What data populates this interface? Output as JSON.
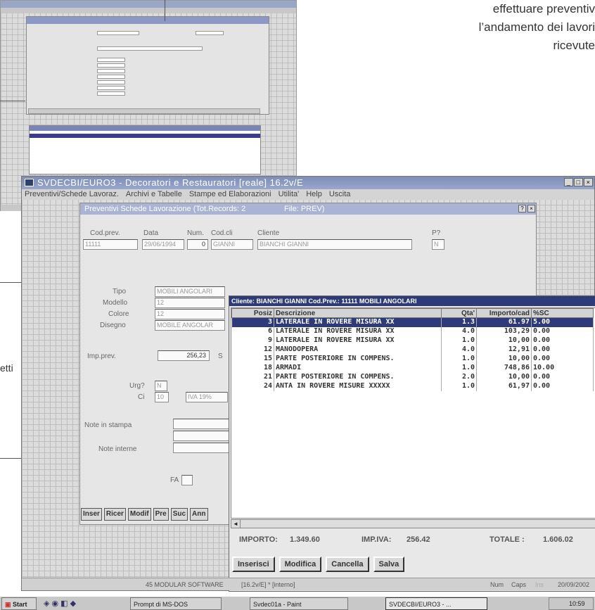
{
  "caption": {
    "lines": [
      "effettuare preventiv",
      "l’andamento dei lavori",
      "ricevute"
    ],
    "side_label": "etti"
  },
  "window": {
    "title": "SVDECBI/EURO3 - Decoratori e Restauratori        [reale]   16.2v/E",
    "menu": [
      "Preventivi/Schede Lavoraz.",
      "Archivi e Tabelle",
      "Stampe ed Elaborazioni",
      "Utilita'",
      "Help",
      "Uscita"
    ]
  },
  "form": {
    "title": "Preventivi Schede Lavorazione  (Tot.Records: 2",
    "file": "File: PREV)",
    "labels": {
      "codprev": "Cod.prev.",
      "data": "Data",
      "num": "Num.",
      "codcli": "Cod.cli",
      "cliente": "Cliente",
      "p": "P?",
      "tipo": "Tipo",
      "modello": "Modello",
      "colore": "Colore",
      "disegno": "Disegno",
      "impprev": "Imp.prev.",
      "s": "S",
      "urg": "Urg?",
      "ci": "Ci",
      "note_stampa": "Note in stampa",
      "note_interne": "Note interne",
      "fa": "FA"
    },
    "values": {
      "codprev": "11111",
      "data": "29/06/1994",
      "num": "0",
      "codcli": "GIANNI",
      "cliente": "BIANCHI GIANNI",
      "p": "N",
      "tipo": "MOBILI ANGOLARI",
      "modello": "12",
      "colore": "12",
      "disegno": "MOBILE ANGOLAR",
      "impprev": "256,23",
      "urg": "N",
      "ci": "10",
      "iva": "IVA 19%"
    },
    "buttons": [
      "Inser",
      "Ricer",
      "Modif",
      "Pre",
      "Suc",
      "Ann"
    ]
  },
  "table": {
    "title": "Cliente: BIANCHI GIANNI  Cod.Prev.: 11111  MOBILI ANGOLARI",
    "headers": [
      "Posiz",
      "Descrizione",
      "Qta'",
      "Importo/cad",
      "%SC"
    ],
    "rows": [
      [
        "3",
        "LATERALE IN ROVERE MISURA XX",
        "1.3",
        "61.97",
        "5.00"
      ],
      [
        "6",
        "LATERALE IN ROVERE MISURA XX",
        "4.0",
        "103,29",
        "0.00"
      ],
      [
        "9",
        "LATERALE IN ROVERE MISURA XX",
        "1.0",
        "10,00",
        "0.00"
      ],
      [
        "12",
        "MANODOPERA",
        "4.0",
        "12,91",
        "0.00"
      ],
      [
        "15",
        "PARTE POSTERIORE IN COMPENS.",
        "1.0",
        "10,00",
        "0.00"
      ],
      [
        "18",
        "ARMADI",
        "1.0",
        "748,86",
        "10.00"
      ],
      [
        "21",
        "PARTE POSTERIORE IN COMPENS.",
        "2.0",
        "10,00",
        "0.00"
      ],
      [
        "24",
        "ANTA IN ROVERE MISURE XXXXX",
        "1.0",
        "61,97",
        "0.00"
      ]
    ],
    "selected_row": 0,
    "totals": {
      "importo_label": "IMPORTO:",
      "importo": "1.349.60",
      "impiva_label": "IMP.IVA:",
      "impiva": "256.42",
      "totale_label": "TOTALE :",
      "totale": "1.606.02"
    },
    "buttons": [
      "Inserisci",
      "Modifica",
      "Cancella",
      "Salva"
    ]
  },
  "status": {
    "product": "45 MODULAR SOFTWARE",
    "version": "[16.2v/E] *  [interno]",
    "num": "Num",
    "caps": "Caps",
    "ins": "Ins",
    "date": "20/09/2002"
  },
  "taskbar": {
    "start": "Start",
    "tasks": [
      "Prompt di MS-DOS",
      "Svdec01a - Paint",
      "SVDECBI/EURO3 - ..."
    ],
    "clock": "10:59"
  },
  "colors": {
    "title_blue": "#7d8db7",
    "select_navy": "#2e3a7a"
  }
}
